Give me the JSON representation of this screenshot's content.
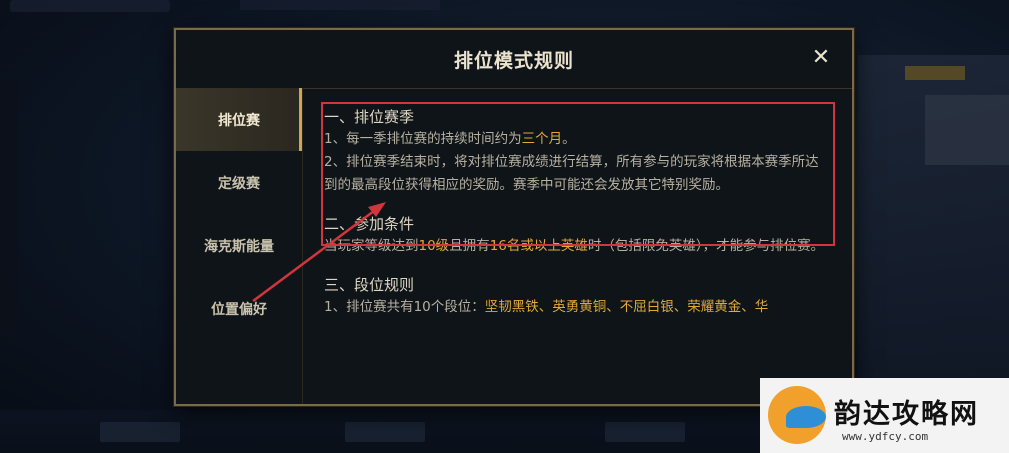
{
  "dialog": {
    "title": "排位模式规则",
    "close_label": "✕"
  },
  "sidebar": {
    "items": [
      {
        "label": "排位赛"
      },
      {
        "label": "定级赛"
      },
      {
        "label": "海克斯能量"
      },
      {
        "label": "位置偏好"
      }
    ]
  },
  "content": {
    "section1": {
      "title": "一、排位赛季",
      "line1_pre": "1、每一季排位赛的持续时间约为",
      "line1_hl": "三个月",
      "line1_post": "。",
      "line2": "2、排位赛季结束时，将对排位赛成绩进行结算，所有参与的玩家将根据本赛季所达到的最高段位获得相应的奖励。赛季中可能还会发放其它特别奖励。"
    },
    "section2": {
      "title": "二、参加条件",
      "pre": "当玩家等级达到",
      "hl1": "10级",
      "mid": "且拥有",
      "hl2": "16名或以上英雄",
      "post": "时（包括限免英雄），才能参与排位赛。"
    },
    "section3": {
      "title": "三、段位规则",
      "pre": "1、排位赛共有10个段位：",
      "hl": "坚韧黑铁、英勇黄铜、不屈白银、荣耀黄金、华"
    }
  },
  "watermark": {
    "name": "韵达攻略网",
    "url": "www.ydfcy.com"
  },
  "colors": {
    "accent_gold": "#c9a85a",
    "highlight": "#e0a93a",
    "annotation_red": "#d1363c"
  }
}
